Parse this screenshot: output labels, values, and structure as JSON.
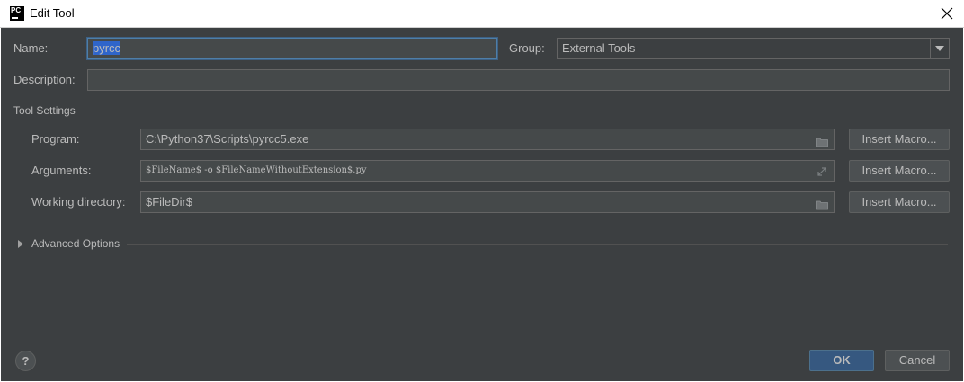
{
  "window": {
    "app_icon_text": "PC",
    "title": "Edit Tool"
  },
  "form": {
    "name_label": "Name:",
    "name_value": "pyrcc",
    "group_label": "Group:",
    "group_value": "External Tools",
    "description_label": "Description:",
    "description_value": ""
  },
  "tool_settings": {
    "section_label": "Tool Settings",
    "program_label": "Program:",
    "program_value": "C:\\Python37\\Scripts\\pyrcc5.exe",
    "arguments_label": "Arguments:",
    "arguments_value": "$FileName$ -o $FileNameWithoutExtension$.py",
    "working_dir_label": "Working directory:",
    "working_dir_value": "$FileDir$",
    "insert_macro_label": "Insert Macro..."
  },
  "advanced": {
    "label": "Advanced Options",
    "expanded": false
  },
  "footer": {
    "help_label": "?",
    "ok_label": "OK",
    "cancel_label": "Cancel"
  },
  "colors": {
    "background": "#3c3f41",
    "field_bg": "#45494a",
    "default_button": "#365880",
    "selection": "#2f65ca"
  }
}
